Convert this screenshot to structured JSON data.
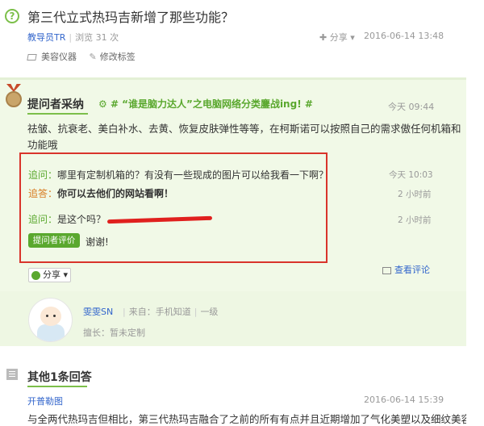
{
  "question": {
    "title": "第三代立式热玛吉新增了那些功能？",
    "asker": "教导员TR",
    "views": "浏览 31 次",
    "share": "分享",
    "date": "2016-06-14 13:48",
    "tags": [
      "美容仪器"
    ],
    "edit_tags": "修改标签"
  },
  "best_answer": {
    "header": "提问者采纳",
    "topic": "# “谁是脑力达人”之电脑网络分类鏖战ing! #",
    "time": "今天 09:44",
    "text": "祛皱、抗衰老、美白补水、去黄、恢复皮肤弹性等等，在柯斯诺可以按照自己的需求傲任何机箱和功能哦",
    "conversation": [
      {
        "label": "追问：",
        "text": "哪里有定制机箱的？有没有一些现成的图片可以给我看一下啊？",
        "time": "今天 10:03"
      },
      {
        "label": "追答：",
        "text": "你可以去他们的网站看啊！",
        "time": "2 小时前"
      },
      {
        "label": "追问：",
        "text": "是这个吗？",
        "time": "2 小时前"
      }
    ],
    "eval_button": "提问者评价",
    "eval_text": "谢谢!",
    "share": "分享",
    "view_comments": "查看评论"
  },
  "answerer": {
    "name": "雯雯SN",
    "source": "来自：手机知道",
    "level": "一级",
    "skill": "擅长：暂未定制"
  },
  "other": {
    "title": "其他1条回答",
    "user": "开普勒图",
    "date": "2016-06-14 15:39",
    "text": "与全两代热玛吉但相比，第三代热玛吉融合了之前的所有有点并且近期增加了气化美塑以及细纹美容"
  },
  "colors": {
    "accent_green": "#5aa82e",
    "highlight_box": "#d9342b",
    "link_blue": "#3366cc"
  }
}
